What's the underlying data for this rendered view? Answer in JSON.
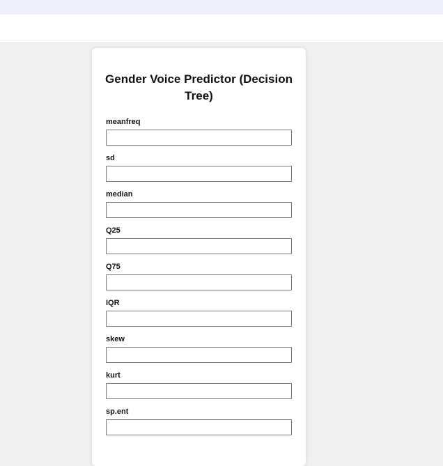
{
  "page": {
    "title": "Gender Voice Predictor (Decision Tree)"
  },
  "form": {
    "fields": [
      {
        "label": "meanfreq",
        "value": ""
      },
      {
        "label": "sd",
        "value": ""
      },
      {
        "label": "median",
        "value": ""
      },
      {
        "label": "Q25",
        "value": ""
      },
      {
        "label": "Q75",
        "value": ""
      },
      {
        "label": "IQR",
        "value": ""
      },
      {
        "label": "skew",
        "value": ""
      },
      {
        "label": "kurt",
        "value": ""
      },
      {
        "label": "sp.ent",
        "value": ""
      }
    ]
  },
  "colors": {
    "browser_bar": "#eef1fa",
    "page_background": "#f0f0f0",
    "card_background": "#ffffff",
    "input_border": "#767676"
  }
}
